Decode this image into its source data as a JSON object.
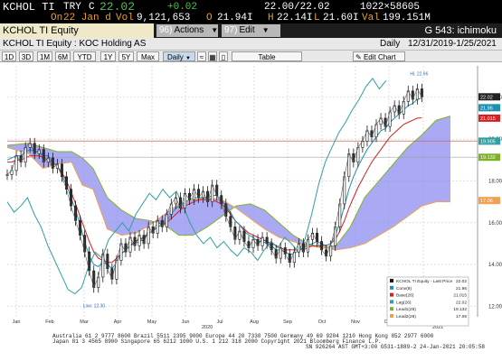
{
  "quote": {
    "ticker": "KCHOL TI",
    "currency": "TRY",
    "c_label": "C",
    "last": "22.02",
    "change": "+0.02",
    "bid_ask": "22.00/22.02",
    "size": "1022×58605",
    "date_label": "On",
    "date": "22 Jan d",
    "vol_label": "Vol",
    "volume": "9,121,653",
    "open_label": "O",
    "open": "21.94I",
    "high_label": "H",
    "high": "22.14I",
    "low_label": "L",
    "low": "21.60I",
    "val_label": "Val",
    "value": "199.151M"
  },
  "titlebar": {
    "security": "KCHOL TI Equity",
    "actions_num": "96)",
    "actions_label": "Actions",
    "edit_num": "97)",
    "edit_label": "Edit",
    "chart_name": "G 543: ichimoku"
  },
  "infobar": {
    "security_name": "KCHOL TI Equity : KOC Holding AS",
    "periodicity": "Daily",
    "range": "12/31/2019-1/25/2021"
  },
  "toolbar": {
    "ranges": [
      "1D",
      "3D",
      "1M",
      "6M",
      "YTD",
      "1Y",
      "5Y",
      "Max"
    ],
    "selected_period": "Daily",
    "table_label": "Table",
    "edit_chart_label": "Edit Chart"
  },
  "colors": {
    "price": "#1a1a1a",
    "conversion": "#1e90b4",
    "base": "#d42020",
    "lagging": "#30a0a0",
    "lead1": "#7fb22b",
    "lead2": "#f0a050",
    "cloud": "#8c8cf0",
    "hline": "#d06060"
  },
  "chart_data": {
    "type": "line",
    "x_ticks": [
      "Jan",
      "Feb",
      "Mar",
      "Apr",
      "May",
      "Jun",
      "Jul",
      "Aug",
      "Sep",
      "Oct",
      "Nov",
      "Dec",
      "Jan"
    ],
    "x_years": [
      "2020",
      "2021"
    ],
    "y_ticks": [
      12,
      14,
      16,
      18,
      20,
      22
    ],
    "ylim": [
      11.5,
      23.5
    ],
    "annotations": {
      "high": "Hi: 22.96",
      "low": "Low: 12.30"
    },
    "axis_badges": [
      {
        "value": "22.02",
        "color": "#222",
        "y": 22.02
      },
      {
        "value": "21.96",
        "color": "#1e90b4",
        "y": 21.5
      },
      {
        "value": "21.015",
        "color": "#d42020",
        "y": 21.0
      },
      {
        "value": "19.905",
        "color": "#30a0a0",
        "y": 19.9
      },
      {
        "value": "19.132",
        "color": "#7fb22b",
        "y": 19.13
      },
      {
        "value": "17.06",
        "color": "#f0a050",
        "y": 17.06
      }
    ],
    "hlines": [
      19.905,
      19.132
    ],
    "price": [
      18.3,
      18.5,
      19.2,
      18.9,
      19.6,
      19.8,
      19.3,
      19.5,
      18.9,
      19.1,
      18.6,
      18.8,
      18.2,
      17.6,
      16.8,
      16.1,
      15.4,
      14.6,
      13.7,
      12.9,
      13.4,
      14.5,
      13.8,
      13.3,
      14.2,
      15.0,
      14.6,
      15.3,
      14.9,
      15.4,
      15.0,
      15.8,
      15.5,
      16.1,
      15.8,
      16.4,
      16.9,
      17.2,
      16.7,
      17.4,
      17.1,
      17.6,
      17.2,
      17.5,
      17.0,
      17.8,
      17.3,
      16.9,
      16.3,
      15.8,
      15.2,
      15.6,
      15.1,
      14.8,
      15.2,
      14.9,
      15.3,
      15.0,
      14.7,
      14.3,
      14.8,
      14.5,
      14.1,
      14.6,
      15.0,
      14.6,
      15.2,
      15.5,
      15.1,
      14.7,
      14.4,
      14.9,
      15.8,
      16.9,
      18.2,
      19.3,
      18.9,
      19.6,
      19.9,
      20.4,
      20.1,
      20.7,
      21.0,
      20.6,
      21.3,
      21.6,
      21.2,
      21.8,
      22.3,
      21.9,
      22.4,
      22.02
    ],
    "conversion": [
      19.0,
      19.1,
      19.2,
      19.2,
      19.4,
      19.5,
      19.4,
      19.4,
      19.2,
      19.2,
      18.9,
      18.7,
      18.3,
      17.8,
      17.2,
      16.6,
      15.9,
      15.1,
      14.4,
      14.0,
      13.9,
      14.1,
      14.0,
      13.8,
      14.1,
      14.5,
      14.7,
      14.9,
      15.0,
      15.1,
      15.2,
      15.5,
      15.6,
      15.8,
      15.9,
      16.1,
      16.4,
      16.7,
      16.8,
      17.0,
      17.1,
      17.2,
      17.2,
      17.2,
      17.2,
      17.3,
      17.3,
      17.1,
      16.8,
      16.5,
      16.1,
      15.9,
      15.6,
      15.4,
      15.3,
      15.1,
      15.1,
      15.0,
      14.9,
      14.7,
      14.7,
      14.6,
      14.5,
      14.5,
      14.7,
      14.8,
      14.9,
      15.0,
      15.1,
      15.0,
      14.9,
      15.0,
      15.4,
      16.0,
      16.8,
      17.6,
      18.2,
      18.7,
      19.1,
      19.5,
      19.8,
      20.1,
      20.4,
      20.5,
      20.8,
      21.0,
      21.2,
      21.4,
      21.6,
      21.7,
      21.9,
      21.96
    ],
    "base": [
      18.9,
      18.9,
      19.0,
      19.0,
      19.1,
      19.2,
      19.2,
      19.2,
      19.1,
      19.0,
      18.9,
      18.7,
      18.4,
      18.0,
      17.5,
      16.9,
      16.3,
      15.7,
      15.1,
      14.6,
      14.3,
      14.2,
      14.1,
      14.1,
      14.3,
      14.5,
      14.7,
      14.9,
      15.1,
      15.2,
      15.3,
      15.5,
      15.6,
      15.8,
      15.9,
      16.0,
      16.2,
      16.4,
      16.6,
      16.8,
      16.9,
      17.0,
      17.1,
      17.1,
      17.1,
      17.1,
      17.0,
      16.9,
      16.7,
      16.4,
      16.1,
      15.9,
      15.7,
      15.5,
      15.4,
      15.3,
      15.2,
      15.1,
      15.0,
      14.9,
      14.8,
      14.7,
      14.7,
      14.7,
      14.7,
      14.7,
      14.8,
      14.9,
      14.9,
      14.9,
      14.9,
      15.0,
      15.2,
      15.6,
      16.1,
      16.7,
      17.2,
      17.7,
      18.1,
      18.5,
      18.9,
      19.2,
      19.5,
      19.8,
      20.1,
      20.3,
      20.5,
      20.7,
      20.8,
      20.9,
      21.0,
      21.015
    ],
    "lagging": [
      17.0,
      16.5,
      16.8,
      17.2,
      16.4,
      15.8,
      14.9,
      14.2,
      13.5,
      12.8,
      12.6,
      12.9,
      13.9,
      14.6,
      14.3,
      15.2,
      15.6,
      16.0,
      15.6,
      16.4,
      16.9,
      17.4,
      17.1,
      17.6,
      17.2,
      17.5,
      16.8,
      16.0,
      15.4,
      15.0,
      15.3,
      14.8,
      15.1,
      14.7,
      14.4,
      14.8,
      14.6,
      14.2,
      14.7,
      15.1,
      14.8,
      15.3,
      15.0,
      14.6,
      15.2,
      16.4,
      17.8,
      18.9,
      19.6,
      20.3,
      20.8,
      21.4,
      21.9,
      22.5,
      22.9,
      22.4,
      22.8
    ],
    "cloud": [
      [
        0,
        19.7,
        19.6
      ],
      [
        6,
        19.8,
        19.3
      ],
      [
        10,
        19.6,
        18.6
      ],
      [
        14,
        19.4,
        18.8
      ],
      [
        18,
        19.4,
        18.9
      ],
      [
        21,
        19.1,
        17.8
      ],
      [
        24,
        18.6,
        17.6
      ],
      [
        28,
        17.2,
        15.7
      ],
      [
        32,
        16.6,
        15.4
      ],
      [
        36,
        16.2,
        15.5
      ],
      [
        40,
        16.1,
        15.9
      ],
      [
        44,
        15.9,
        16.4
      ],
      [
        48,
        15.4,
        16.9
      ],
      [
        52,
        15.4,
        17.1
      ],
      [
        56,
        15.8,
        17.2
      ],
      [
        60,
        16.3,
        17.1
      ],
      [
        64,
        16.8,
        16.7
      ],
      [
        68,
        16.9,
        16.2
      ],
      [
        72,
        16.6,
        15.7
      ],
      [
        76,
        16.0,
        15.3
      ],
      [
        80,
        15.4,
        15.1
      ],
      [
        84,
        15.0,
        14.9
      ],
      [
        88,
        14.8,
        14.8
      ],
      [
        92,
        14.9,
        14.7
      ],
      [
        96,
        15.8,
        14.8
      ],
      [
        100,
        17.2,
        15.0
      ],
      [
        104,
        18.0,
        15.4
      ],
      [
        108,
        18.8,
        15.8
      ],
      [
        112,
        19.6,
        16.3
      ],
      [
        116,
        20.2,
        16.8
      ],
      [
        120,
        20.9,
        17.0
      ],
      [
        124,
        21.1,
        17.0
      ]
    ]
  }
}
